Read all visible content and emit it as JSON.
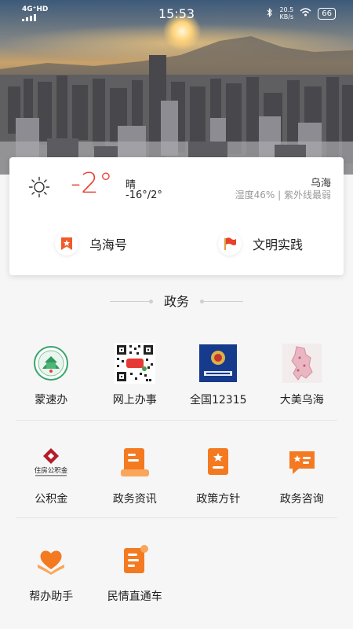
{
  "status_bar": {
    "network": "4G⁺HD",
    "time": "15:53",
    "speed_value": "20.5",
    "speed_unit": "KB/s",
    "battery": "66"
  },
  "weather": {
    "temperature": "-2°",
    "condition": "晴",
    "range": "-16°/2°",
    "city": "乌海",
    "details": "湿度46% | 紫外线最弱",
    "icon": "sun-icon"
  },
  "quick_links": [
    {
      "label": "乌海号",
      "icon": "bookmark-star-icon"
    },
    {
      "label": "文明实践",
      "icon": "red-flag-icon"
    }
  ],
  "section": {
    "title": "政务"
  },
  "services": [
    {
      "label": "蒙速办",
      "icon": "mengsuban-logo-icon"
    },
    {
      "label": "网上办事",
      "icon": "qr-code-icon"
    },
    {
      "label": "全国12315",
      "icon": "12315-emblem-icon"
    },
    {
      "label": "大美乌海",
      "icon": "wuhai-map-icon"
    },
    {
      "label": "公积金",
      "icon": "housing-fund-logo-icon",
      "logo_text": "住房公积金"
    },
    {
      "label": "政务资讯",
      "icon": "news-document-icon"
    },
    {
      "label": "政策方针",
      "icon": "policy-star-document-icon"
    },
    {
      "label": "政务咨询",
      "icon": "consult-chat-icon"
    },
    {
      "label": "帮办助手",
      "icon": "helping-heart-icon"
    },
    {
      "label": "民情直通车",
      "icon": "public-opinion-note-icon"
    }
  ],
  "colors": {
    "accent_orange": "#f47a22",
    "temp_red": "#e74336",
    "background": "#f6f6f6"
  }
}
